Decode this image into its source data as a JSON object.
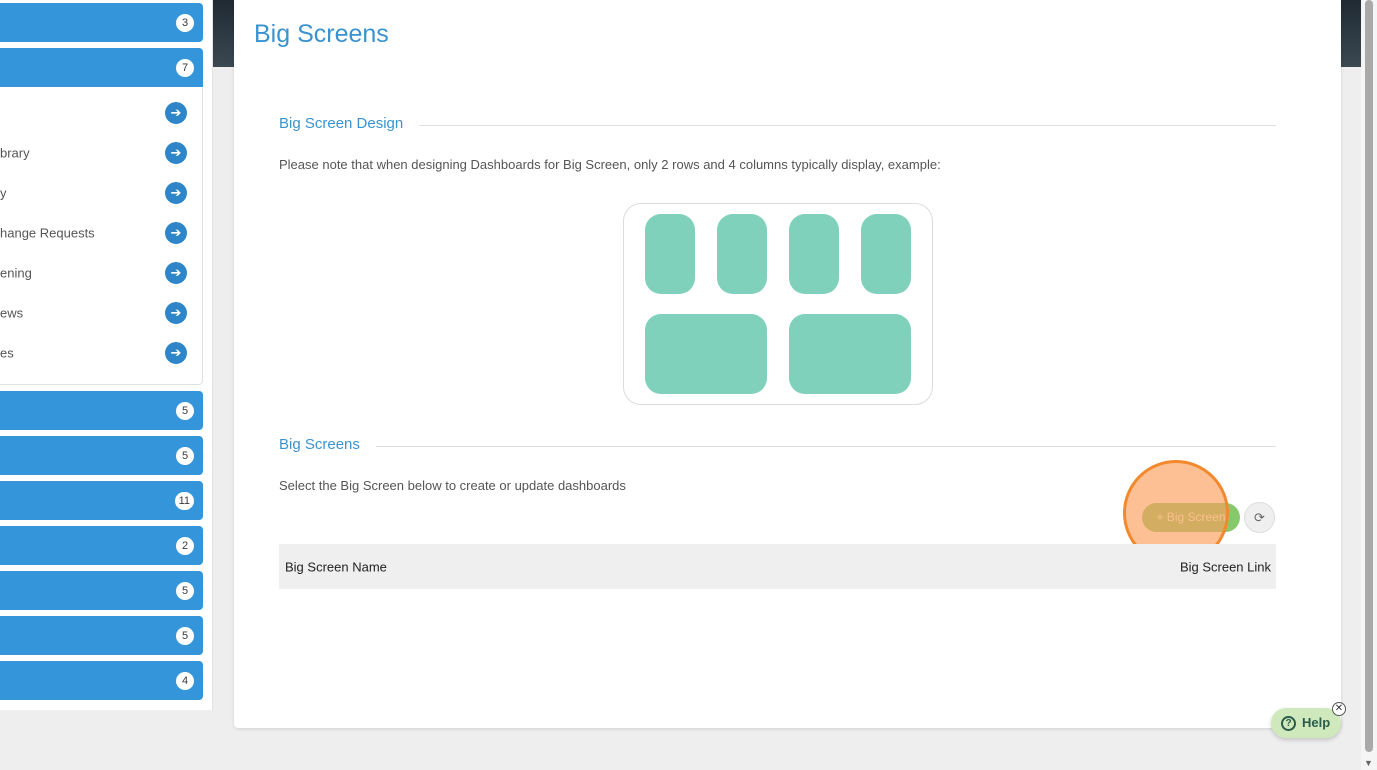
{
  "sidebar": {
    "top_groups": [
      {
        "badge": "3"
      },
      {
        "badge": "7"
      }
    ],
    "sub_items": [
      {
        "label": ""
      },
      {
        "label": "brary"
      },
      {
        "label": "y"
      },
      {
        "label": "hange Requests"
      },
      {
        "label": "ening"
      },
      {
        "label": "ews"
      },
      {
        "label": "es"
      }
    ],
    "bottom_groups": [
      {
        "badge": "5"
      },
      {
        "badge": "5"
      },
      {
        "badge": "11"
      },
      {
        "badge": "2"
      },
      {
        "badge": "5"
      },
      {
        "badge": "5"
      },
      {
        "badge": "4"
      }
    ],
    "arrow_glyph": "➔"
  },
  "main": {
    "title": "Big Screens",
    "design_section": {
      "heading": "Big Screen Design",
      "note": "Please note that when designing Dashboards for Big Screen, only 2 rows and 4 columns typically display, example:"
    },
    "screens_section": {
      "heading": "Big Screens",
      "note": "Select the Big Screen below to create or update dashboards",
      "add_button_label": "+ Big Screen",
      "refresh_icon": "refresh-icon",
      "table_headers": [
        "Big Screen Name",
        "Big Screen Link"
      ]
    }
  },
  "help": {
    "label": "Help",
    "icon_glyph": "?",
    "close_glyph": "✕"
  },
  "colors": {
    "primary_blue": "#3595db",
    "title_blue": "#3a93cf",
    "tile_teal": "#7fd1bc",
    "add_green": "#86c96a",
    "highlight_orange": "#f3892d"
  }
}
